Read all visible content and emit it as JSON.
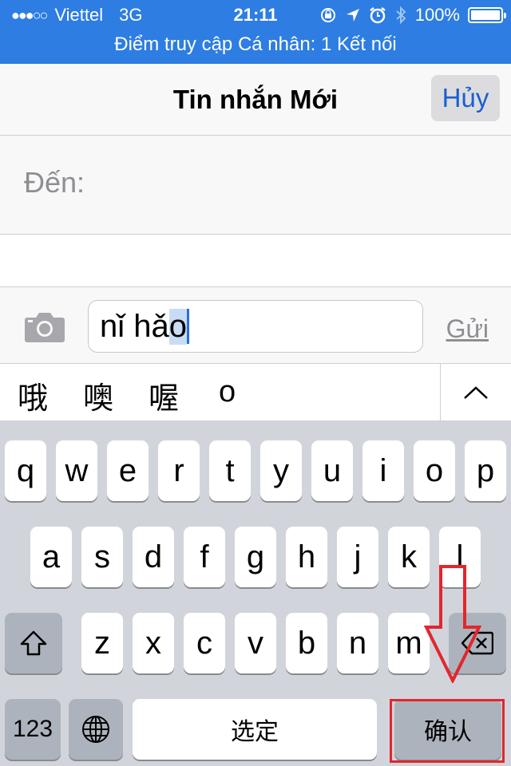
{
  "status_bar": {
    "signal": "●●●○○",
    "carrier": "Viettel",
    "network": "3G",
    "time": "21:11",
    "battery": "100%",
    "icons": [
      "rotation-lock-icon",
      "location-arrow-icon",
      "alarm-icon",
      "bluetooth-icon",
      "battery-icon"
    ],
    "banner": "Điểm truy cập Cá nhân: 1 Kết nối",
    "color": "#2d7de3"
  },
  "nav": {
    "title": "Tin nhắn Mới",
    "cancel": "Hủy"
  },
  "to_field": {
    "label": "Đến:"
  },
  "compose": {
    "text_before": "nǐ hǎ",
    "text_marked": "o",
    "send": "Gửi"
  },
  "candidates": {
    "items": [
      "哦",
      "噢",
      "喔",
      "o"
    ]
  },
  "keyboard": {
    "row1": [
      "q",
      "w",
      "e",
      "r",
      "t",
      "y",
      "u",
      "i",
      "o",
      "p"
    ],
    "row2": [
      "a",
      "s",
      "d",
      "f",
      "g",
      "h",
      "j",
      "k",
      "l"
    ],
    "row3": [
      "z",
      "x",
      "c",
      "v",
      "b",
      "n",
      "m"
    ],
    "numbers": "123",
    "space": "选定",
    "confirm": "确认"
  },
  "annotation": {
    "color": "#e3262d"
  }
}
